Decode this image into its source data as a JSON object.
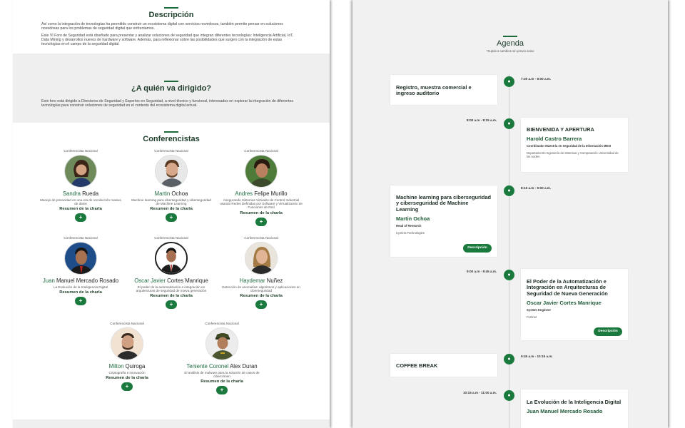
{
  "description": {
    "title": "Descripción",
    "paragraph1": "Así como la integración de tecnologías ha permitido construir un ecosistema digital con servicios novedosos, también permite pensar en soluciones novedosas para los problemas de seguridad digital que enfrentamos.",
    "paragraph2": "Este VI Foro de Seguridad está diseñado para presentar y analizar soluciones de seguridad que integran diferentes tecnologías: Inteligencia Artificial, IoT, Data Mining y desarrollos nuevos de hardware y software. Además, para reflexionar sobre las posibilidades que surgen con la integración de estas tecnologías en el campo de la seguridad digital."
  },
  "audience": {
    "title": "¿A quién va dirigido?",
    "paragraph": "Este foro está dirigido a Directores de Seguridad y Expertos en Seguridad, a nivel técnico y funcional, interesados en explorar la integración de diferentes tecnologías para construir soluciones de seguridad en el contexto del ecosistema digital actual."
  },
  "speakers": {
    "title": "Conferencistas",
    "resumen_label": "Resumen de la charla",
    "plus": "+",
    "items": [
      {
        "kind": "Conferencista Nacional",
        "first": "Sandra",
        "last": "Rueda",
        "talk": "Manejo de privacidad en una era de recolección masiva de datos"
      },
      {
        "kind": "Conferencista Nacional",
        "first": "Martin",
        "last": "Ochoa",
        "talk": "Machine learning para ciberseguridad y ciberseguridad de Machine Learning"
      },
      {
        "kind": "Conferencista Nacional",
        "first": "Andres",
        "last": "Felipe Murillo",
        "talk": "Asegurando Sistemas Virtuales de Control Industrial usando Redes Definidas por Software y Virtualización de Funciones de Red"
      },
      {
        "kind": "Conferencista Nacional",
        "first": "Juan",
        "last": "Manuel Mercado Rosado",
        "talk": "La Evolución de la Inteligencia Digital"
      },
      {
        "kind": "Conferencista Nacional",
        "first": "Oscar Javier",
        "last": "Cortes Manrique",
        "talk": "El poder de la automatización e integración en arquitecturas de seguridad de nueva generación"
      },
      {
        "kind": "Conferencista Nacional",
        "first": "Haydemar",
        "last": "Nuñez",
        "talk": "Detección de anomalías: algoritmos y aplicaciones en ciberseguridad"
      },
      {
        "kind": "Conferencista Nacional",
        "first": "Milton",
        "last": "Quiroga",
        "talk": "Criptografía e innovación"
      },
      {
        "kind": "Conferencista Nacional",
        "first": "Teniente Coronel",
        "last": "Alex Duran",
        "talk": "El análisis de malware para la solución de casos de cibercrimen"
      }
    ]
  },
  "agenda": {
    "title": "Agenda",
    "note": "*Sujeta a cambios sin previo aviso",
    "button_label": "Descripción",
    "items": [
      {
        "time": "7:30 a.m - 8:00 a.m.",
        "title": "Registro, muestra comercial e ingreso auditorio",
        "speaker": "",
        "role": "",
        "org": ""
      },
      {
        "time": "8:00 a.m - 8:15 a.m.",
        "title": "BIENVENIDA Y APERTURA",
        "speaker": "Harold Castro Barrera",
        "role": "Coordinador Maestría en Seguridad de la Información MESI",
        "org": "Departamento Ingeniería de Sistemas y Computación Universidad de los Andes"
      },
      {
        "time": "8:15 a.m - 9:00 a.m.",
        "title": "Machine learning para ciberseguridad y ciberseguridad de Machine Learning",
        "speaker": "Martin Ochoa",
        "role": "Head of Research",
        "org": "Cyxtera Technologies"
      },
      {
        "time": "9:00 a.m - 9:45 a.m.",
        "title": "El Poder de la Automatización e Integración en Arquitecturas de Seguridad de Nueva Generación",
        "speaker": "Oscar Javier Cortes Manrique",
        "role": "System Engineer",
        "org": "Fortinet"
      },
      {
        "time": "9:45 a.m - 10:15 a.m.",
        "title": "COFFEE BREAK",
        "speaker": "",
        "role": "",
        "org": ""
      },
      {
        "time": "10:15 a.m - 11:00 a.m.",
        "title": "La Evolución de la Inteligencia Digital",
        "speaker": "Juan Manuel Mercado Rosado",
        "role": "",
        "org": ""
      }
    ]
  },
  "colors": {
    "accent": "#1a7a3e",
    "title": "#1e3e2a",
    "panel": "#efefef"
  }
}
